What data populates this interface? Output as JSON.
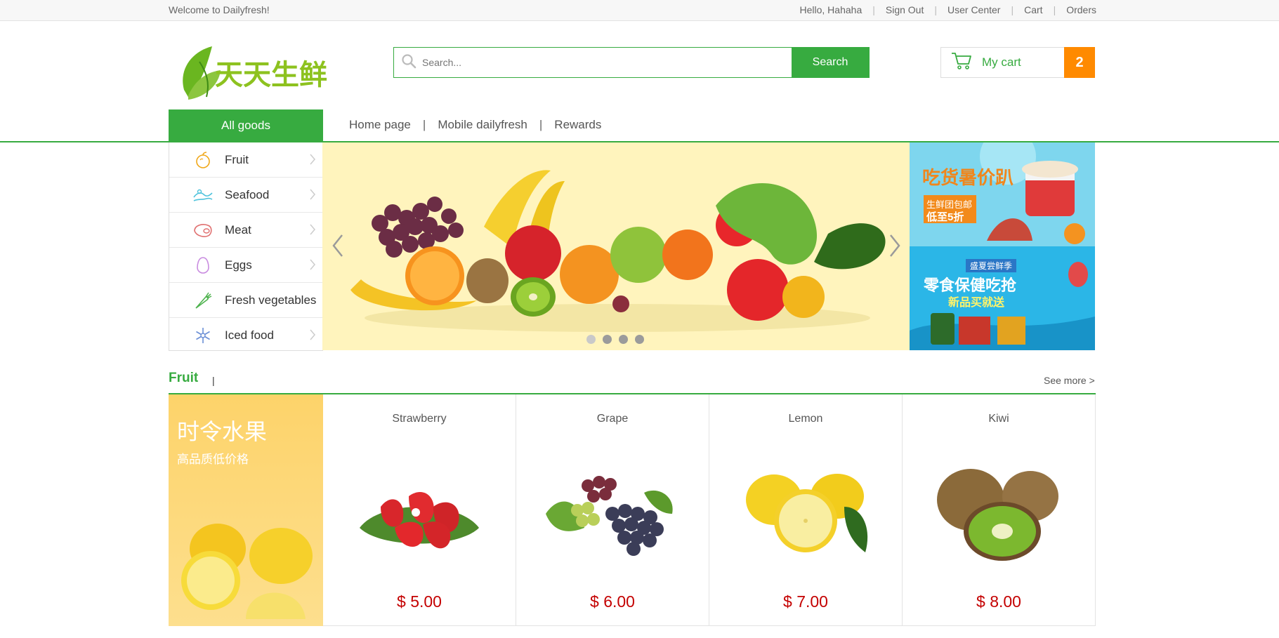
{
  "topbar": {
    "welcome": "Welcome to Dailyfresh!",
    "greeting": "Hello, Hahaha",
    "links": [
      "Sign Out",
      "User Center",
      "Cart",
      "Orders"
    ]
  },
  "header": {
    "logo_text": "天天生鲜",
    "search": {
      "placeholder": "Search...",
      "button": "Search"
    },
    "cart": {
      "label": "My cart",
      "count": "2"
    }
  },
  "nav": {
    "all_goods": "All goods",
    "links": [
      "Home page",
      "Mobile dailyfresh",
      "Rewards"
    ]
  },
  "categories": [
    {
      "label": "Fruit",
      "icon": "apple-icon"
    },
    {
      "label": "Seafood",
      "icon": "wave-icon"
    },
    {
      "label": "Meat",
      "icon": "meat-icon"
    },
    {
      "label": "Eggs",
      "icon": "egg-icon"
    },
    {
      "label": "Fresh vegetables",
      "icon": "carrot-icon"
    },
    {
      "label": "Iced food",
      "icon": "snowflake-icon"
    }
  ],
  "banner": {
    "slides": 4,
    "active_slide": 1,
    "ad_top": {
      "title": "吃货暑价趴",
      "line1": "生鲜团包邮",
      "line2": "低至5折"
    },
    "ad_bottom": {
      "tag": "盛夏尝鲜季",
      "line1": "零食保健吃抢",
      "line2": "新品买就送"
    }
  },
  "fruit_section": {
    "title": "Fruit",
    "pipe": "|",
    "see_more": "See more >",
    "promo": {
      "title": "时令水果",
      "subtitle": "高品质低价格"
    },
    "products": [
      {
        "name": "Strawberry",
        "price": "$ 5.00"
      },
      {
        "name": "Grape",
        "price": "$ 6.00"
      },
      {
        "name": "Lemon",
        "price": "$ 7.00"
      },
      {
        "name": "Kiwi",
        "price": "$ 8.00"
      }
    ]
  },
  "colors": {
    "brand_green": "#37ab40",
    "cart_orange": "#ff8a00",
    "price_red": "#c40000"
  }
}
